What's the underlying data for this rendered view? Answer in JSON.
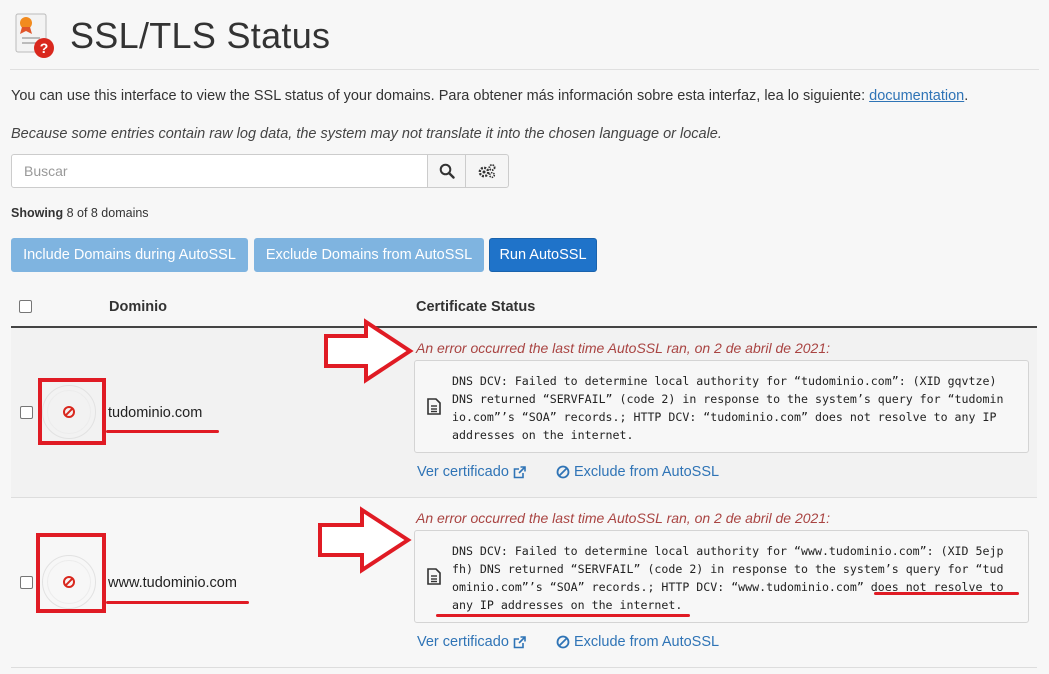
{
  "page": {
    "title": "SSL/TLS Status",
    "intro_text": "You can use this interface to view the SSL status of your domains. Para obtener más información sobre esta interfaz, lea lo siguiente:",
    "intro_link": "documentation",
    "intro_end": ".",
    "note": "Because some entries contain raw log data, the system may not translate it into the chosen language or locale."
  },
  "search": {
    "placeholder": "Buscar"
  },
  "showing": {
    "label": "Showing",
    "text": "8 of 8 domains"
  },
  "buttons": {
    "include": "Include Domains during AutoSSL",
    "exclude": "Exclude Domains from AutoSSL",
    "run": "Run AutoSSL"
  },
  "table": {
    "col_domain": "Dominio",
    "col_status": "Certificate Status",
    "rows": [
      {
        "domain": "tudominio.com",
        "error": "An error occurred the last time AutoSSL ran, on 2 de abril de 2021:",
        "log": "DNS DCV: Failed to determine local authority for “tudominio.com”: (XID gqvtze) DNS returned “SERVFAIL” (code 2) in response to the system’s query for “tudomin io.com”’s “SOA” records.; HTTP DCV: “tudominio.com” does not resolve to any IP addresses on the internet.",
        "view_cert": "Ver certificado",
        "exclude": "Exclude from AutoSSL"
      },
      {
        "domain": "www.tudominio.com",
        "error": "An error occurred the last time AutoSSL ran, on 2 de abril de 2021:",
        "log": "DNS DCV: Failed to determine local authority for “www.tudominio.com”: (XID 5ejp fh) DNS returned “SERVFAIL” (code 2) in response to the system’s query for “tud ominio.com”’s “SOA” records.; HTTP DCV: “www.tudominio.com” does not resolve to any IP addresses on the internet.",
        "view_cert": "Ver certificado",
        "exclude": "Exclude from AutoSSL"
      }
    ]
  },
  "colors": {
    "accent": "#1f73c9",
    "error": "#a94442",
    "annotation": "#e01b24",
    "link": "#2f74b6"
  }
}
